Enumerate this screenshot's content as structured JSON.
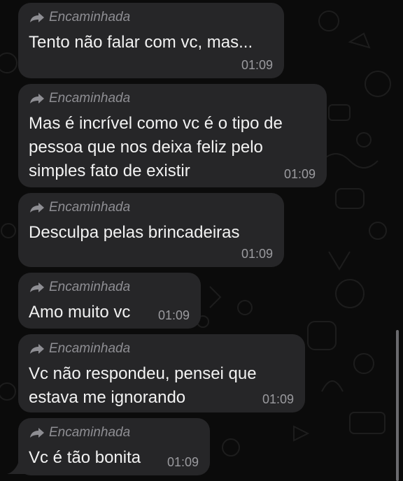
{
  "messages": [
    {
      "forwarded_label": "Encaminhada",
      "text": "Tento não falar com vc, mas...",
      "time": "01:09"
    },
    {
      "forwarded_label": "Encaminhada",
      "text": "Mas é incrível como vc é o tipo de\npessoa que nos deixa feliz pelo\nsimples fato de existir",
      "time": "01:09"
    },
    {
      "forwarded_label": "Encaminhada",
      "text": "Desculpa pelas brincadeiras",
      "time": "01:09"
    },
    {
      "forwarded_label": "Encaminhada",
      "text": "Amo muito vc",
      "time": "01:09"
    },
    {
      "forwarded_label": "Encaminhada",
      "text": "Vc não respondeu, pensei que\nestava me ignorando",
      "time": "01:09"
    },
    {
      "forwarded_label": "Encaminhada",
      "text": "Vc é tão bonita",
      "time": "01:09"
    }
  ],
  "icons": {
    "forward": "forward-arrow-icon"
  },
  "colors": {
    "bubble": "#262628",
    "text": "#f2f2f2",
    "meta": "#8e8e93",
    "background": "#0b0b0b"
  }
}
